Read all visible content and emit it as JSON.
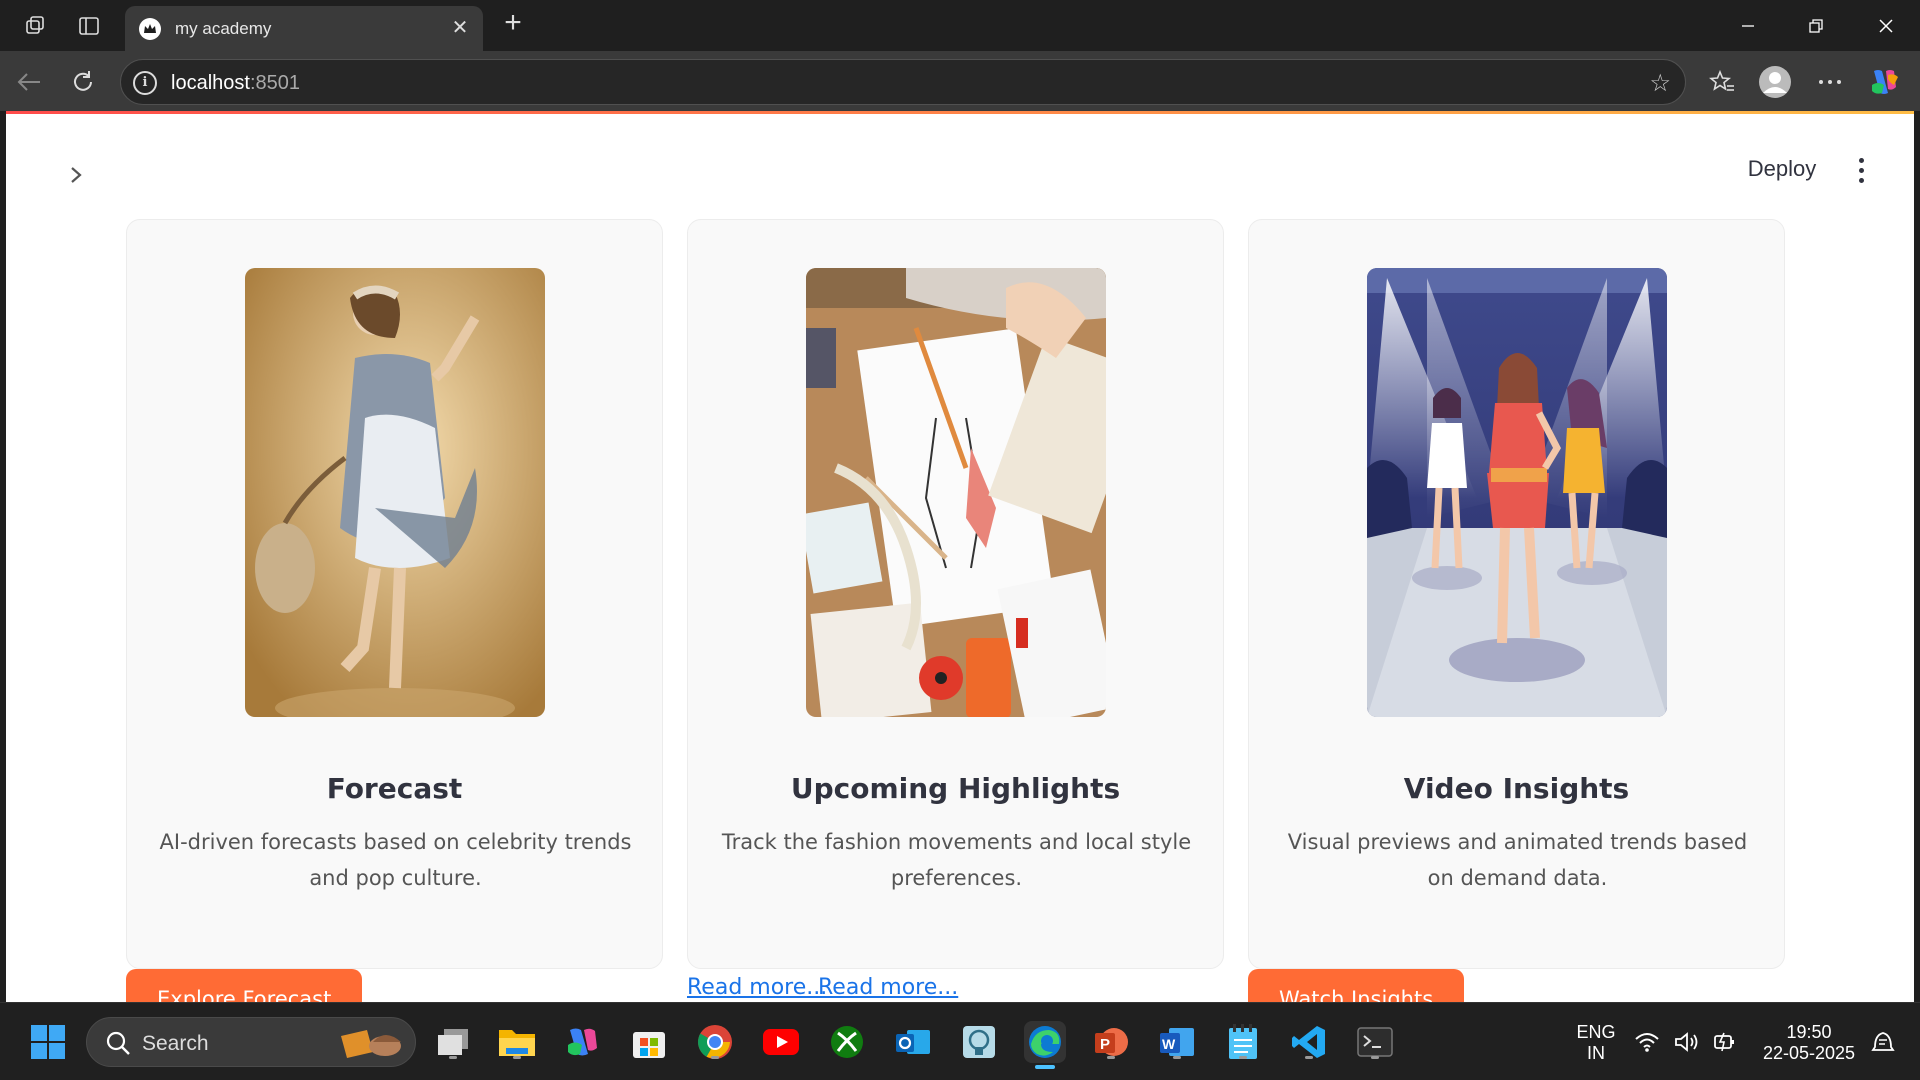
{
  "browser": {
    "tab_title": "my academy",
    "url_host": "localhost",
    "url_port": ":8501",
    "close_glyph": "✕",
    "new_tab_glyph": "+"
  },
  "app": {
    "deploy_label": "Deploy",
    "cards": [
      {
        "title": "Forecast",
        "description": "AI-driven forecasts based on celebrity trends and pop culture.",
        "button": "Explore Forecast"
      },
      {
        "title": "Upcoming Highlights",
        "description": "Track the fashion movements and local style preferences.",
        "links": [
          "Read more...",
          "Read more..."
        ]
      },
      {
        "title": "Video Insights",
        "description": "Visual previews and animated trends based on demand data.",
        "button": "Watch Insights"
      }
    ],
    "accent": "#ff6b35"
  },
  "taskbar": {
    "search_label": "Search",
    "language_line1": "ENG",
    "language_line2": "IN",
    "time": "19:50",
    "date": "22-05-2025"
  }
}
